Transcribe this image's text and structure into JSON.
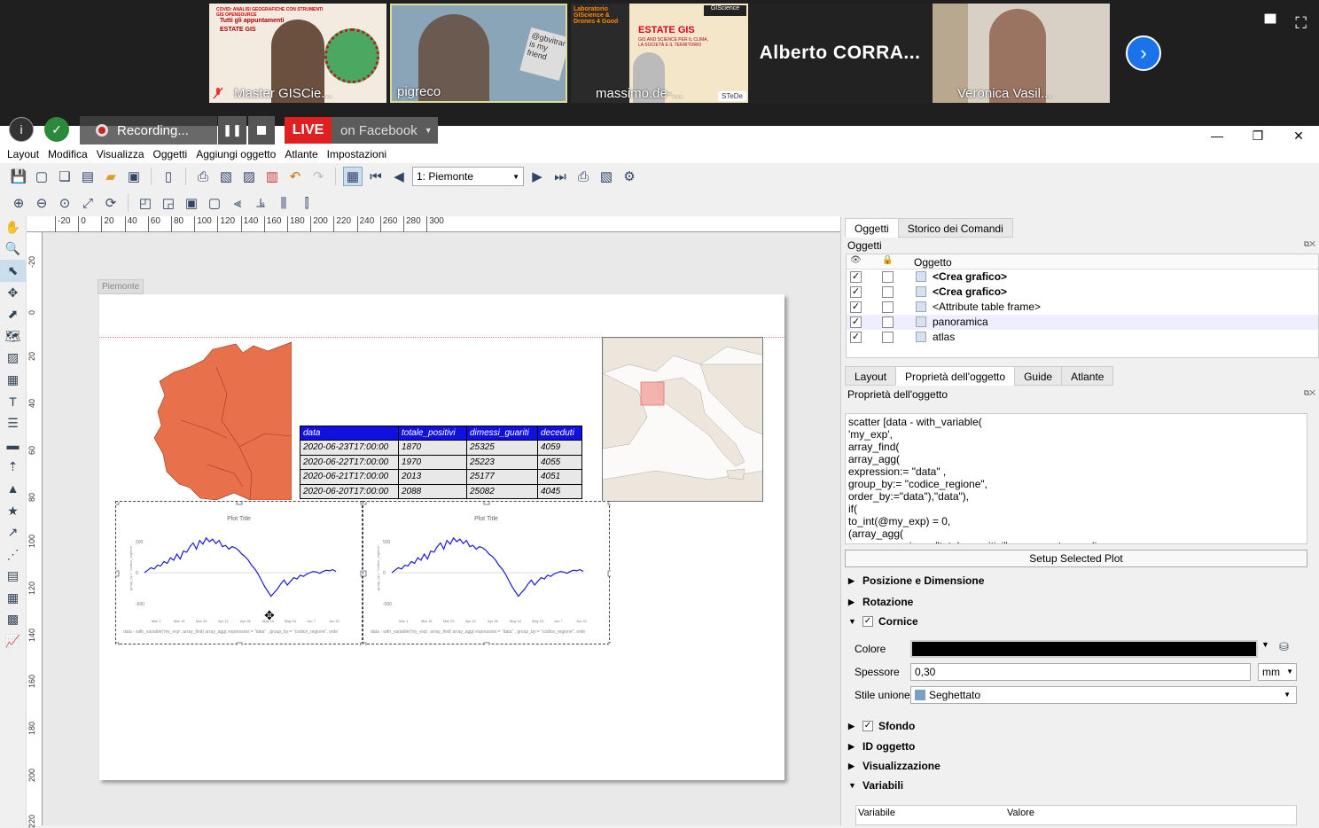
{
  "meeting": {
    "participants": [
      {
        "name": "Master GISCie..."
      },
      {
        "name": "pigreco"
      },
      {
        "name": "massimo.de-..."
      },
      {
        "name": "Alberto  CORRA..."
      },
      {
        "name": "Veronica Vasil..."
      }
    ],
    "slide1_title": "COVID: ANALISI GEOGRAFICHE CON STRUMENTI GIS OPENSOURCE",
    "slide1_sub": "Tutti gli appuntamenti",
    "slide1_head": "ESTATE GIS",
    "slide3_title": "ESTATE GIS",
    "slide3_sub": "GIS AND SCIENCE PER IL CLIMA, LA SOCIETÀ E IL TERRITORIO",
    "slide3_lab": "Laboratorio GIScience & Drones 4 Good",
    "slide3_brand": "GIScience",
    "slide3_logo": "STeDe",
    "sign_text": "@gbvitrano is my friend"
  },
  "recorder": {
    "status": "Recording...",
    "live": "LIVE",
    "platform": "on Facebook"
  },
  "menubar": [
    "Layout",
    "Modifica",
    "Visualizza",
    "Oggetti",
    "Aggiungi oggetto",
    "Atlante",
    "Impostazioni"
  ],
  "atlas": {
    "current": "1: Piemonte"
  },
  "page": {
    "label": "Piemonte"
  },
  "attribute_table": {
    "headers": [
      "data",
      "totale_positivi",
      "dimessi_guariti",
      "deceduti"
    ],
    "rows": [
      [
        "2020-06-23T17:00:00",
        "1870",
        "25325",
        "4059"
      ],
      [
        "2020-06-22T17:00:00",
        "1970",
        "25223",
        "4055"
      ],
      [
        "2020-06-21T17:00:00",
        "2013",
        "25177",
        "4051"
      ],
      [
        "2020-06-20T17:00:00",
        "2088",
        "25082",
        "4045"
      ]
    ]
  },
  "plots": [
    {
      "title": "Plot Title",
      "footer": "data - with_variable('my_exp', array_find( array_agg( expression:= \"data\" , group_by:= \"codice_regione\", orde",
      "ylabel": "group_by:= \"codice_regione\",",
      "xticks": [
        "Mar 1",
        "Mar 15",
        "Mar 29",
        "Apr 12",
        "Apr 26",
        "May 10",
        "May 24",
        "Jun 7",
        "Jun 21"
      ],
      "yticks": [
        "500",
        "0",
        "-500"
      ]
    },
    {
      "title": "Plot Title",
      "footer": "data - with_variable('my_exp', array_find( array_agg( expression:= \"data\" , group_by:= \"codice_regione\", orde",
      "ylabel": "group_by:= \"codice_regione\",",
      "xticks": [
        "Mar 1",
        "Mar 15",
        "Mar 29",
        "Apr 12",
        "Apr 26",
        "May 10",
        "May 24",
        "Jun 7",
        "Jun 21"
      ],
      "yticks": [
        "500",
        "0",
        "-500"
      ]
    }
  ],
  "right_panel": {
    "tabs_top": [
      "Oggetti",
      "Storico dei Comandi"
    ],
    "objects_title": "Oggetti",
    "objects_col": "Oggetto",
    "objects": [
      {
        "name": "<Crea grafico>",
        "bold": true
      },
      {
        "name": "<Crea grafico>",
        "bold": true
      },
      {
        "name": "<Attribute table frame>",
        "bold": false
      },
      {
        "name": "panoramica",
        "bold": false
      },
      {
        "name": "atlas",
        "bold": false
      }
    ],
    "tabs_bottom": [
      "Layout",
      "Proprietà dell'oggetto",
      "Guide",
      "Atlante"
    ],
    "props_title": "Proprietà dell'oggetto",
    "expression": "scatter [data - with_variable(\n'my_exp',\narray_find(\narray_agg(\nexpression:= \"data\" ,\ngroup_by:= \"codice_regione\",\norder_by:=\"data\"),\"data\"),\nif(\nto_int(@my_exp) = 0,\n(array_agg(\n        expression:= \"totale_positivi\"     parametro medico",
    "setup_button": "Setup Selected Plot",
    "sections": [
      "Posizione e Dimensione",
      "Rotazione",
      "Cornice",
      "Sfondo",
      "ID oggetto",
      "Visualizzazione",
      "Variabili"
    ],
    "colore_label": "Colore",
    "spessore_label": "Spessore",
    "spessore_value": "0,30",
    "unit": "mm",
    "stile_label": "Stile unione",
    "stile_value": "Seghettato",
    "var_cols": [
      "Variabile",
      "Valore"
    ]
  },
  "ruler_top": [
    "-20",
    "0",
    "20",
    "40",
    "60",
    "80",
    "100",
    "120",
    "140",
    "160",
    "180",
    "200",
    "220",
    "240",
    "260",
    "280",
    "300"
  ],
  "ruler_left": [
    "-20",
    "0",
    "20",
    "40",
    "60",
    "80",
    "100",
    "120",
    "140",
    "160",
    "180",
    "200",
    "220"
  ],
  "colors": {
    "region": "#e8704a",
    "header_blue": "#1010e0",
    "plot_line": "#1a1ad0",
    "live": "#e02020"
  }
}
